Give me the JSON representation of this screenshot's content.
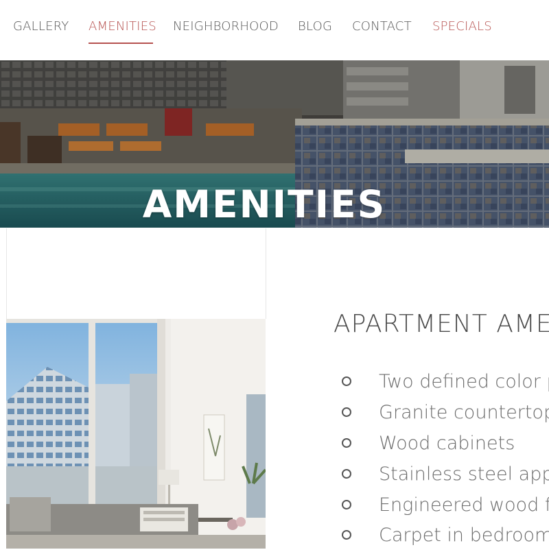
{
  "nav": {
    "items": [
      {
        "label": "GALLERY"
      },
      {
        "label": "AMENITIES"
      },
      {
        "label": "NEIGHBORHOOD"
      },
      {
        "label": "BLOG"
      },
      {
        "label": "CONTACT"
      },
      {
        "label": "SPECIALS"
      }
    ],
    "active_index": 1,
    "accent_color": "#b6514f"
  },
  "hero": {
    "title": "AMENITIES"
  },
  "section": {
    "heading": "APARTMENT AMEN",
    "amenities": [
      "Two defined color p",
      "Granite countertops",
      "Wood cabinets",
      "Stainless steel appl",
      "Engineered wood f",
      "Carpet in bedrooms"
    ]
  }
}
